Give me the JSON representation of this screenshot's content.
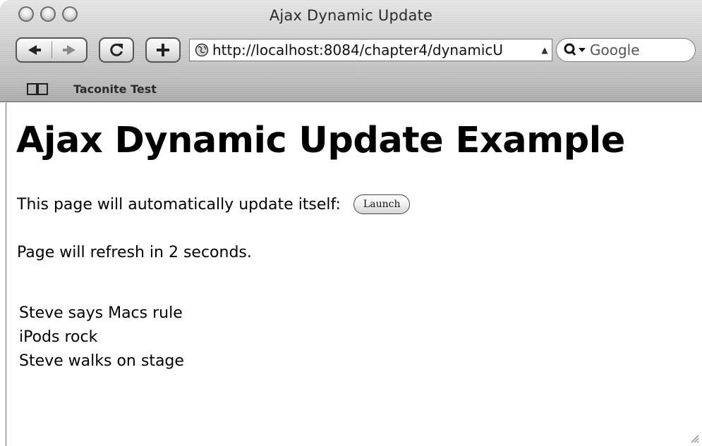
{
  "window": {
    "title": "Ajax Dynamic Update"
  },
  "toolbar": {
    "address_url": "http://localhost:8084/chapter4/dynamicU",
    "search_placeholder": "Google",
    "icons": [
      "back-arrow-icon",
      "forward-arrow-icon",
      "reload-icon",
      "add-bookmark-icon",
      "globe-icon",
      "search-icon",
      "book-icon"
    ]
  },
  "bookmarks": {
    "items": [
      {
        "label": "Taconite Test"
      }
    ]
  },
  "page": {
    "heading": "Ajax Dynamic Update Example",
    "intro_text": "This page will automatically update itself:",
    "launch_label": "Launch",
    "refresh_text": "Page will refresh in 2 seconds.",
    "messages": [
      "Steve says Macs rule",
      "iPods rock",
      "Steve walks on stage"
    ]
  }
}
